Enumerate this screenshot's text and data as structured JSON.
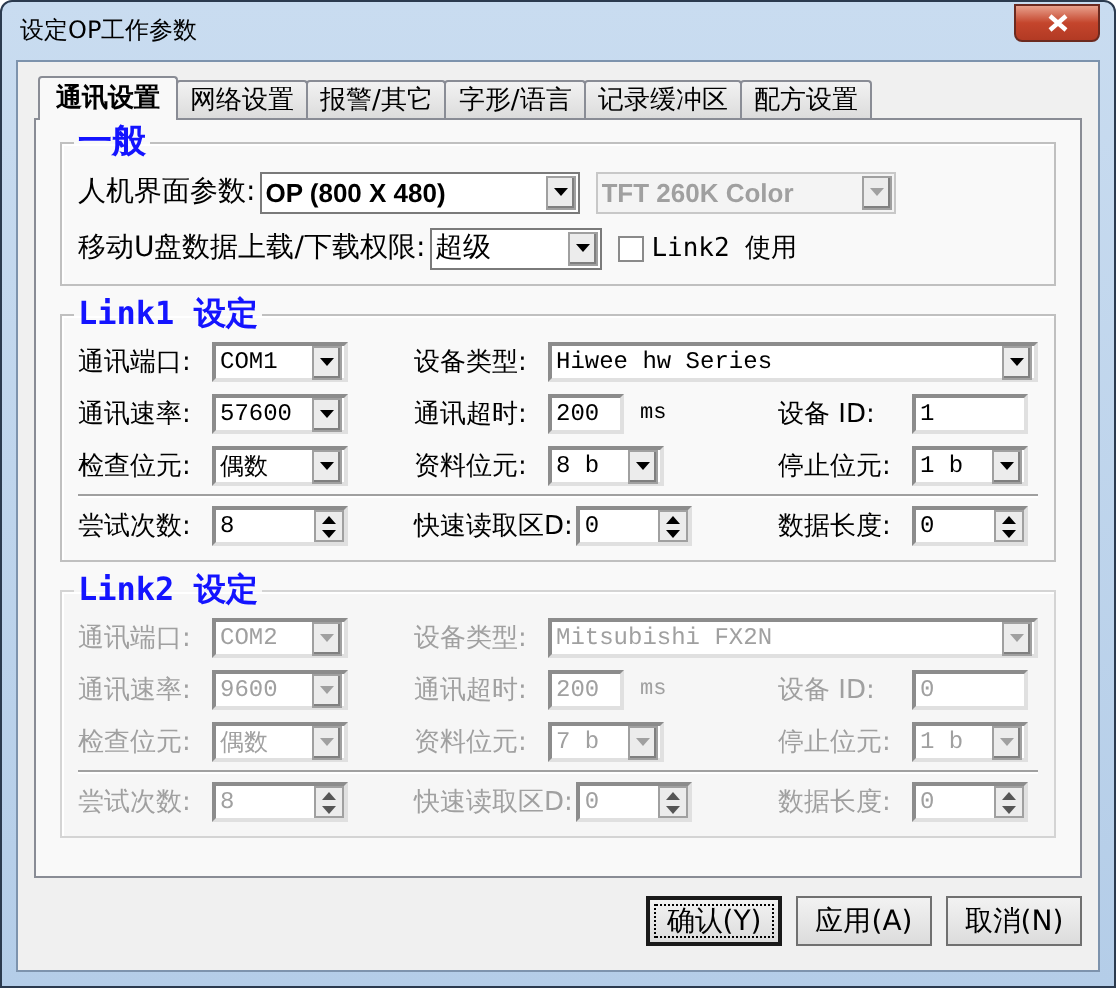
{
  "window": {
    "title": "设定OP工作参数"
  },
  "tabs": [
    {
      "label": "通讯设置",
      "selected": true
    },
    {
      "label": "网络设置",
      "selected": false
    },
    {
      "label": "报警/其它",
      "selected": false
    },
    {
      "label": "字形/语言",
      "selected": false
    },
    {
      "label": "记录缓冲区",
      "selected": false
    },
    {
      "label": "配方设置",
      "selected": false
    }
  ],
  "general": {
    "title": "一般",
    "rows": [
      {
        "label": "人机界面参数:",
        "fields": [
          {
            "kind": "combo",
            "value": "OP (800 X 480)",
            "disabled": false
          },
          {
            "kind": "combo",
            "value": "TFT 260K Color",
            "disabled": true
          }
        ]
      },
      {
        "label": "移动U盘数据上载/下载权限:",
        "fields": [
          {
            "kind": "combo",
            "value": "超级",
            "disabled": false
          },
          {
            "kind": "checkbox",
            "label": "Link2 使用",
            "checked": false
          }
        ]
      }
    ]
  },
  "links": [
    {
      "title": "Link1 设定",
      "disabled": false,
      "rows": [
        [
          {
            "kind": "combo",
            "label": "通讯端口:",
            "value": "COM1"
          },
          {
            "kind": "combo",
            "label": "设备类型:",
            "value": "Hiwee hw Series"
          }
        ],
        [
          {
            "kind": "combo",
            "label": "通讯速率:",
            "value": "57600"
          },
          {
            "kind": "text",
            "label": "通讯超时:",
            "value": "200",
            "unit": "ms"
          },
          {
            "kind": "text",
            "label": "设备 ID:",
            "value": "1"
          }
        ],
        [
          {
            "kind": "combo",
            "label": "检查位元:",
            "value": "偶数"
          },
          {
            "kind": "combo",
            "label": "资料位元:",
            "value": "8 b"
          },
          {
            "kind": "combo",
            "label": "停止位元:",
            "value": "1 b"
          }
        ],
        [
          {
            "kind": "spin",
            "label": "尝试次数:",
            "value": "8"
          },
          {
            "kind": "spin",
            "label": "快速读取区D:",
            "value": "0"
          },
          {
            "kind": "spin",
            "label": "数据长度:",
            "value": "0"
          }
        ]
      ]
    },
    {
      "title": "Link2 设定",
      "disabled": true,
      "rows": [
        [
          {
            "kind": "combo",
            "label": "通讯端口:",
            "value": "COM2"
          },
          {
            "kind": "combo",
            "label": "设备类型:",
            "value": "Mitsubishi FX2N"
          }
        ],
        [
          {
            "kind": "combo",
            "label": "通讯速率:",
            "value": "9600"
          },
          {
            "kind": "text",
            "label": "通讯超时:",
            "value": "200",
            "unit": "ms"
          },
          {
            "kind": "text",
            "label": "设备 ID:",
            "value": "0"
          }
        ],
        [
          {
            "kind": "combo",
            "label": "检查位元:",
            "value": "偶数"
          },
          {
            "kind": "combo",
            "label": "资料位元:",
            "value": "7 b"
          },
          {
            "kind": "combo",
            "label": "停止位元:",
            "value": "1 b"
          }
        ],
        [
          {
            "kind": "spin",
            "label": "尝试次数:",
            "value": "8"
          },
          {
            "kind": "spin",
            "label": "快速读取区D:",
            "value": "0"
          },
          {
            "kind": "spin",
            "label": "数据长度:",
            "value": "0"
          }
        ]
      ]
    }
  ],
  "buttons": [
    {
      "label": "确认(Y)",
      "default": true
    },
    {
      "label": "应用(A)",
      "default": false
    },
    {
      "label": "取消(N)",
      "default": false
    }
  ]
}
